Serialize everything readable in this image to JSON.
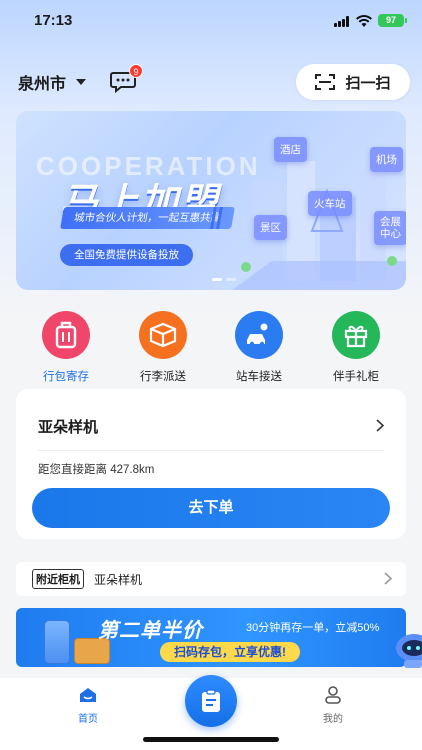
{
  "status_bar": {
    "time": "17:13",
    "battery": "97"
  },
  "header": {
    "city": "泉州市",
    "message_badge": "9",
    "scan_label": "扫一扫"
  },
  "banner": {
    "watermark": "COOPERATION",
    "title": "马上加盟",
    "ribbon": "城市合伙人计划，一起互惠共赢",
    "pill": "全国免费提供设备投放",
    "tags": [
      "酒店",
      "机场",
      "火车站",
      "景区",
      "会展\n中心"
    ]
  },
  "quick_actions": [
    {
      "label": "行包寄存",
      "icon": "luggage-icon",
      "color": "#f0466a"
    },
    {
      "label": "行李派送",
      "icon": "delivery-box-icon",
      "color": "#f5701f"
    },
    {
      "label": "站车接送",
      "icon": "car-icon",
      "color": "#2a7cf0"
    },
    {
      "label": "伴手礼柜",
      "icon": "gift-icon",
      "color": "#25b85a"
    }
  ],
  "card": {
    "title": "亚朵样机",
    "distance": "距您直接距离 427.8km",
    "order_button": "去下单"
  },
  "nearby": {
    "tag": "附近柜机",
    "text": "亚朵样机"
  },
  "promo": {
    "title": "第二单半价",
    "note": "30分钟再存一单，立减50%",
    "pill": "扫码存包，立享优惠!"
  },
  "tabbar": {
    "home": "首页",
    "me": "我的"
  },
  "colors": {
    "accent": "#1e6fe8",
    "badge": "#ff3b30"
  }
}
